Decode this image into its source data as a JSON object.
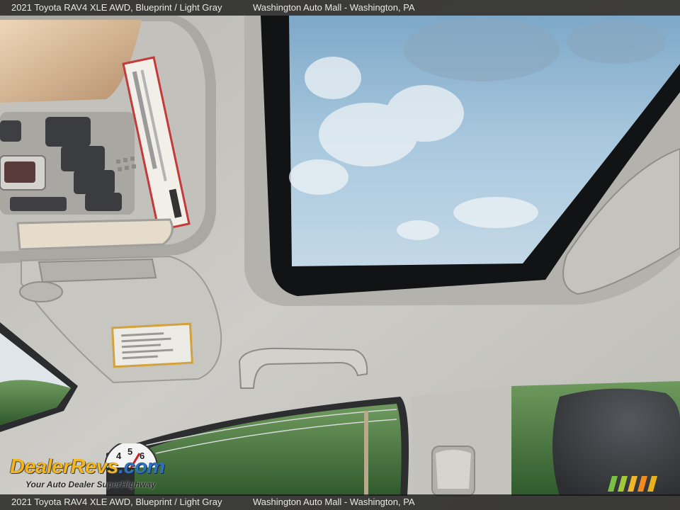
{
  "caption": {
    "vehicle": "2021 Toyota RAV4 XLE AWD,  Blueprint / Light Gray",
    "dealer": "Washington Auto Mall - Washington, PA"
  },
  "watermark": {
    "brand": "DealerRevs",
    "brand_prefix": "Dealer",
    "brand_suffix": "Revs",
    "brand_tld": ".com",
    "tagline": "Your Auto Dealer SuperHighway",
    "gauge_digits": [
      "4",
      "5",
      "6"
    ]
  },
  "colors": {
    "headliner": "#c9c8c3",
    "sky": "#9ec3de",
    "logo_gold": "#f2b51d",
    "logo_blue": "#2f72b8",
    "stripes": [
      "#7ac142",
      "#a5c83a",
      "#f0b52a",
      "#f28a20",
      "#e8b21f"
    ]
  },
  "scene": {
    "description_icons": [
      "sunroof",
      "overhead-console",
      "sun-visor",
      "grab-handle",
      "rear-seat"
    ]
  }
}
